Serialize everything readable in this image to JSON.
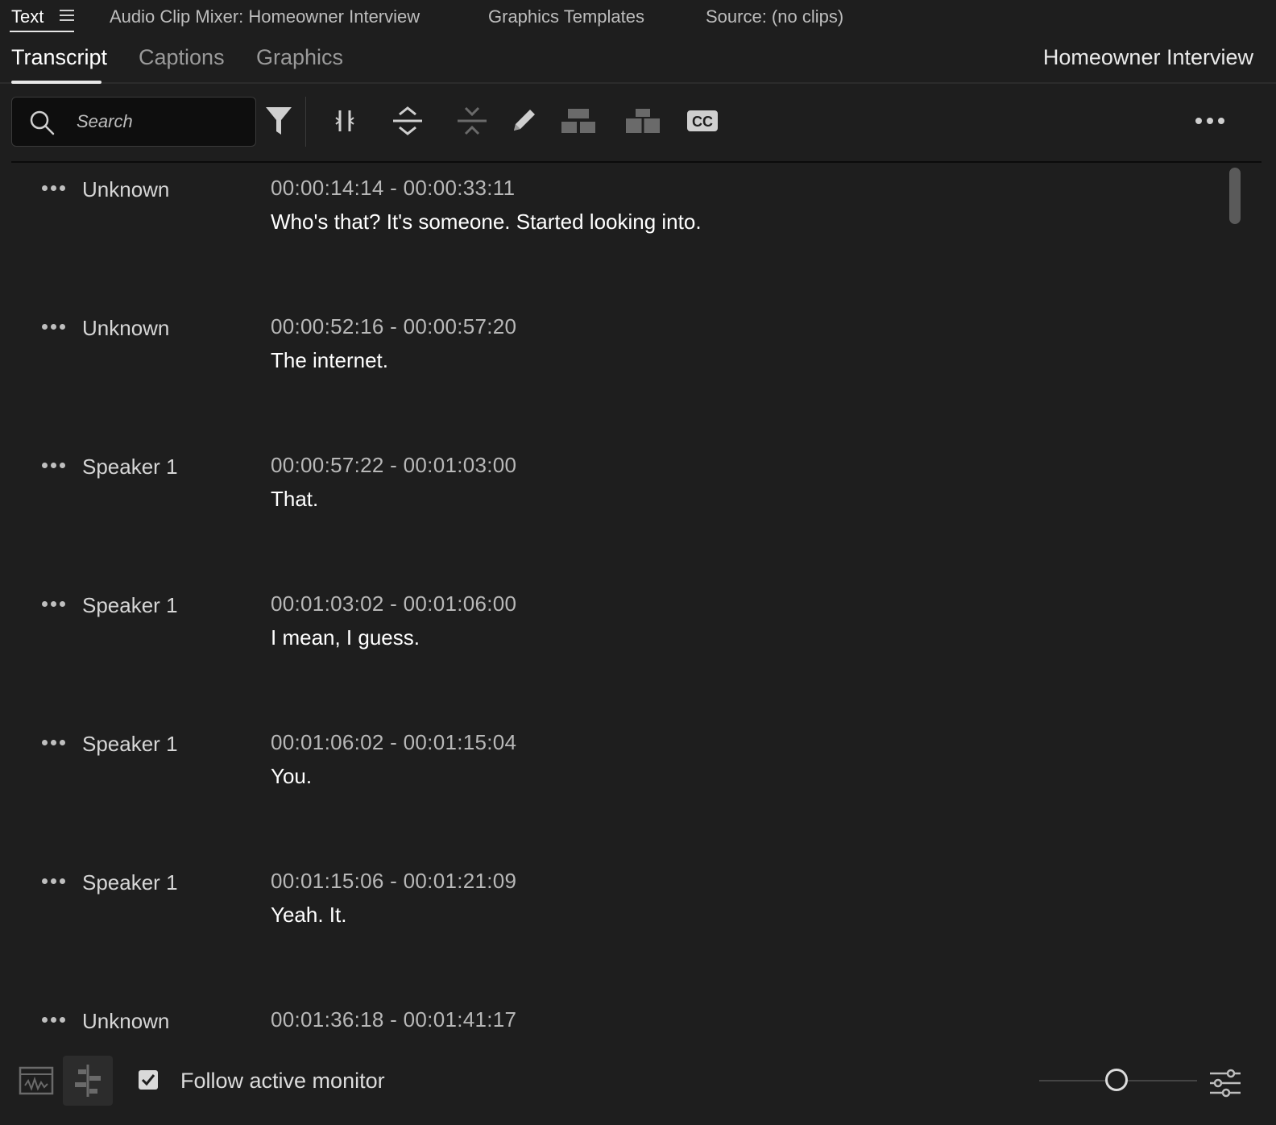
{
  "panel_tabs": {
    "text": "Text",
    "audio_clip_mixer": "Audio Clip Mixer: Homeowner Interview",
    "graphics_templates": "Graphics Templates",
    "source": "Source: (no clips)"
  },
  "subtabs": {
    "transcript": "Transcript",
    "captions": "Captions",
    "graphics": "Graphics",
    "sequence_title": "Homeowner Interview"
  },
  "search": {
    "placeholder": "Search"
  },
  "transcript": {
    "rows": [
      {
        "speaker": "Unknown",
        "timecode": "00:00:14:14 - 00:00:33:11",
        "text": "Who's that? It's someone. Started looking into."
      },
      {
        "speaker": "Unknown",
        "timecode": "00:00:52:16 - 00:00:57:20",
        "text": "The internet."
      },
      {
        "speaker": "Speaker 1",
        "timecode": "00:00:57:22 - 00:01:03:00",
        "text": "That."
      },
      {
        "speaker": "Speaker 1",
        "timecode": "00:01:03:02 - 00:01:06:00",
        "text": "I mean, I guess."
      },
      {
        "speaker": "Speaker 1",
        "timecode": "00:01:06:02 - 00:01:15:04",
        "text": "You."
      },
      {
        "speaker": "Speaker 1",
        "timecode": "00:01:15:06 - 00:01:21:09",
        "text": "Yeah. It."
      },
      {
        "speaker": "Unknown",
        "timecode": "00:01:36:18 - 00:01:41:17",
        "text": ""
      }
    ]
  },
  "footer": {
    "follow_label": "Follow active monitor",
    "follow_checked": true
  }
}
